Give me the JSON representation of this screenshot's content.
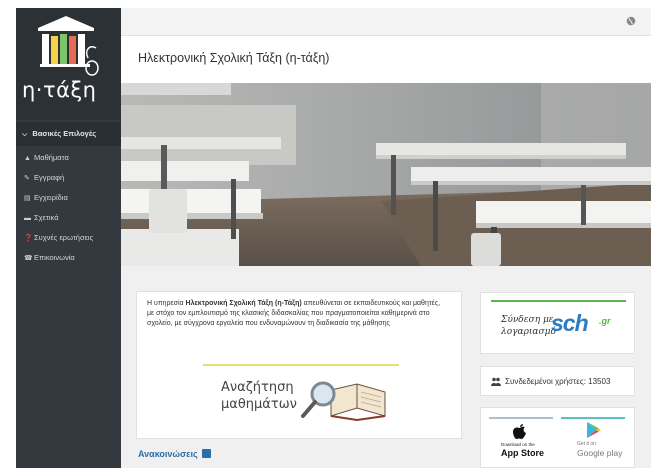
{
  "sidebar": {
    "logo_text": "η·τάξη",
    "menu_header": "Βασικές Επιλογές",
    "items": [
      {
        "label": "Μαθήματα",
        "icon": "graduation-cap-icon"
      },
      {
        "label": "Εγγραφή",
        "icon": "edit-icon"
      },
      {
        "label": "Εγχειρίδια",
        "icon": "file-icon"
      },
      {
        "label": "Σχετικά",
        "icon": "card-icon"
      },
      {
        "label": "Συχνές ερωτήσεις",
        "icon": "question-circle-icon"
      },
      {
        "label": "Επικοινωνία",
        "icon": "phone-icon"
      }
    ]
  },
  "header": {
    "title": "Ηλεκτρονική Σχολική Τάξη (η-τάξη)",
    "globe_icon": "globe-icon"
  },
  "intro": {
    "text_before": "Η υπηρεσία ",
    "text_bold": "Ηλεκτρονική Σχολική Τάξη (η-Τάξη)",
    "text_after": " απευθύνεται σε εκπαιδευτικούς και μαθητές, με στόχο τον εμπλουτισμό της κλασικής διδασκαλίας που πραγματοποιείται καθημερινά στο σχολείο, με σύγχρονα εργαλεία που ενδυναμώνουν τη διαδικασία της μάθησης",
    "search_line1": "Αναζήτηση",
    "search_line2": "μαθημάτων"
  },
  "announcements": {
    "title": "Ανακοινώσεις"
  },
  "login": {
    "line1": "Σύνδεση με",
    "line2": "λογαριασμό",
    "sch": "sch",
    "gr": ".gr"
  },
  "users": {
    "text": "Συνδεδεμένοι χρήστες: 13503"
  },
  "stores": {
    "apple_small": "Download on the",
    "apple_big": "App Store",
    "google_small": "Get it on",
    "google_big": "Google play"
  },
  "colors": {
    "sidebar_bg": "#33393f",
    "accent_blue": "#2a6fa8",
    "sch_blue": "#2a7bc6",
    "sch_green": "#5ab64a",
    "search_yellow": "#ecdc6e"
  }
}
